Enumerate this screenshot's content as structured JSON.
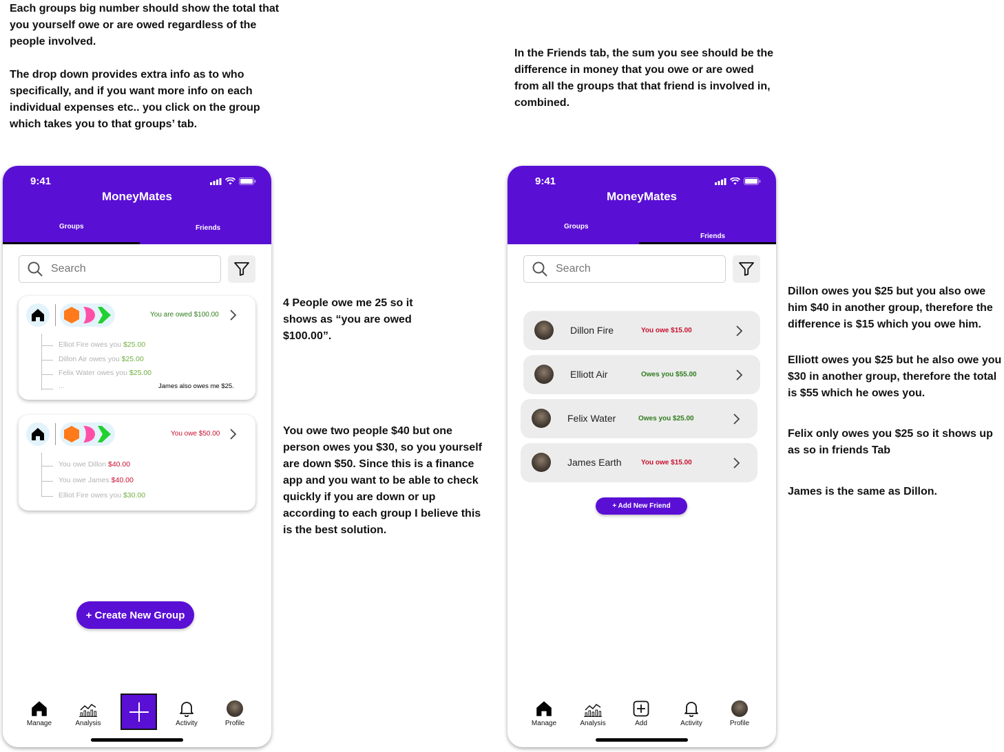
{
  "annotations": {
    "top_left": [
      "Each groups big number should show the total that you yourself owe or are owed regardless of the people involved.",
      "The drop down provides extra info as to who specifically, and if you want more info on each individual expenses etc.. you click on the group which takes you to that groups’ tab."
    ],
    "top_right": "In the Friends tab, the sum you see should be the difference in money that you owe or are owed from all the groups that that friend is involved in, combined.",
    "group1_note": "4 People owe me 25 so it shows as “you are owed $100.00”.",
    "group2_note": "You owe two people $40 but one person owes you $30, so you yourself are down $50. Since this is a finance app and you want to be able to check quickly if you are down or up according to each group I believe this is the best solution.",
    "friends_notes": [
      "Dillon owes you $25 but you also owe him $40 in another group, therefore the difference is $15 which you owe him.",
      "Elliott owes you $25 but he also owe you $30 in another group, therefore the total is $55 which he owes you.",
      "Felix only owes you $25 so it shows up as so in friends Tab",
      "James is the same as Dillon."
    ]
  },
  "app": {
    "time": "9:41",
    "title": "MoneyMates",
    "tabs": {
      "groups": "Groups",
      "friends": "Friends"
    },
    "search_placeholder": "Search",
    "accent_color": "#5a0fd5"
  },
  "groups_screen": {
    "active_tab": "Groups",
    "groups": [
      {
        "summary": "You are owed $100.00",
        "summary_color": "#2f7d1d",
        "members": [
          {
            "prefix": "Elliot Fire owes you ",
            "amount": "$25.00",
            "tone": "green"
          },
          {
            "prefix": "Dillon Air owes you ",
            "amount": "$25.00",
            "tone": "green"
          },
          {
            "prefix": "Felix Water owes you ",
            "amount": "$25.00",
            "tone": "green"
          },
          {
            "prefix": "...",
            "amount": "",
            "tone": "green"
          }
        ],
        "extra_note": "James also owes me $25."
      },
      {
        "summary": "You owe $50.00",
        "summary_color": "#c8102e",
        "members": [
          {
            "prefix": "You owe Dillon ",
            "amount": "$40.00",
            "tone": "red"
          },
          {
            "prefix": "You owe James ",
            "amount": "$40.00",
            "tone": "red"
          },
          {
            "prefix": "Elliot Fire owes you ",
            "amount": "$30.00",
            "tone": "green"
          }
        ]
      }
    ],
    "create_button": "+ Create New Group"
  },
  "friends_screen": {
    "active_tab": "Friends",
    "friends": [
      {
        "name": "Dillon Fire",
        "amount": "You owe $15.00",
        "tone": "red"
      },
      {
        "name": "Elliott Air",
        "amount": "Owes you $55.00",
        "tone": "green"
      },
      {
        "name": "Felix Water",
        "amount": "Owes you $25.00",
        "tone": "green"
      },
      {
        "name": "James Earth",
        "amount": "You owe $15.00",
        "tone": "red"
      }
    ],
    "add_button": "+ Add New Friend"
  },
  "bottom_nav": {
    "manage": "Manage",
    "analysis": "Analysis",
    "add": "Add",
    "activity": "Activity",
    "profile": "Profile"
  }
}
